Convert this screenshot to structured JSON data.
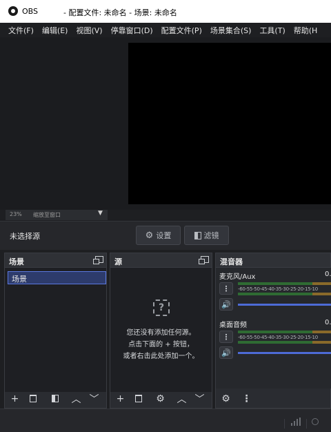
{
  "titlebar": {
    "app": "OBS",
    "title": "- 配置文件: 未命名 - 场景: 未命名"
  },
  "menu": [
    {
      "label": "文件(F)"
    },
    {
      "label": "编辑(E)"
    },
    {
      "label": "视图(V)"
    },
    {
      "label": "停靠窗口(D)"
    },
    {
      "label": "配置文件(P)"
    },
    {
      "label": "场景集合(S)"
    },
    {
      "label": "工具(T)"
    },
    {
      "label": "帮助(H"
    }
  ],
  "zoom": {
    "value": "23%",
    "mode": "缩放至窗口"
  },
  "source_toolbar": {
    "no_source": "未选择源",
    "settings": "设置",
    "filters": "滤镜"
  },
  "scenes": {
    "title": "场景",
    "items": [
      {
        "label": "场景"
      }
    ]
  },
  "sources": {
    "title": "源",
    "empty_line1": "您还没有添加任何源。",
    "empty_line2": "点击下面的 + 按钮，",
    "empty_line3": "或者右击此处添加一个。"
  },
  "mixer": {
    "title": "混音器",
    "channels": [
      {
        "name": "麦克风/Aux",
        "value": "0."
      },
      {
        "name": "桌面音频",
        "value": "0."
      }
    ],
    "scale": "-60-55-50-45-40-35-30-25-20-15-10"
  },
  "colors": {
    "accent": "#4d6bd6",
    "meter_green": "#2f6b33",
    "meter_orange": "#8a6a2a"
  }
}
